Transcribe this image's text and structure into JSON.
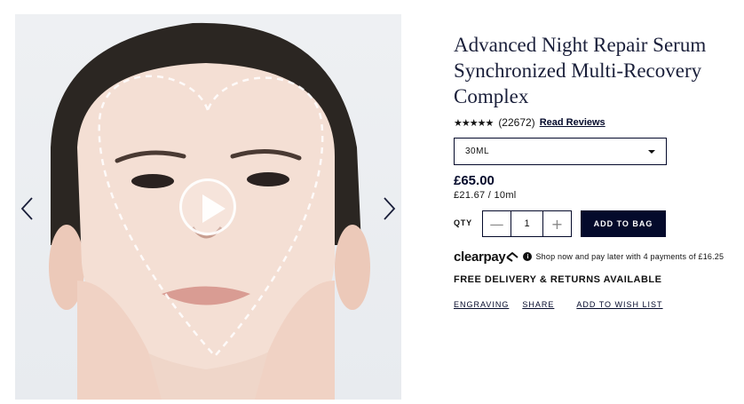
{
  "media": {
    "prev_icon": "chevron-left-icon",
    "next_icon": "chevron-right-icon",
    "play_icon": "play-icon"
  },
  "product": {
    "title": "Advanced Night Repair Serum Synchronized Multi-Recovery Complex",
    "stars": "★★★★★",
    "rating_out_of_5": 4.5,
    "review_count": "(22672)",
    "read_reviews": "Read Reviews",
    "size_selected": "30ML",
    "price": "£65.00",
    "unit_price": "£21.67 / 10ml"
  },
  "purchase": {
    "qty_label": "QTY",
    "qty_value": "1",
    "minus": "—",
    "plus": "+",
    "add_to_bag": "ADD TO BAG"
  },
  "clearpay": {
    "logo": "clearpay",
    "info_icon": "i",
    "text": "Shop now and pay later with 4 payments of £16.25"
  },
  "delivery_text": "FREE DELIVERY & RETURNS AVAILABLE",
  "links": {
    "engraving": "ENGRAVING",
    "share": "SHARE",
    "wishlist": "ADD TO WISH LIST"
  },
  "colors": {
    "navy": "#040a2b",
    "background": "#ffffff"
  }
}
